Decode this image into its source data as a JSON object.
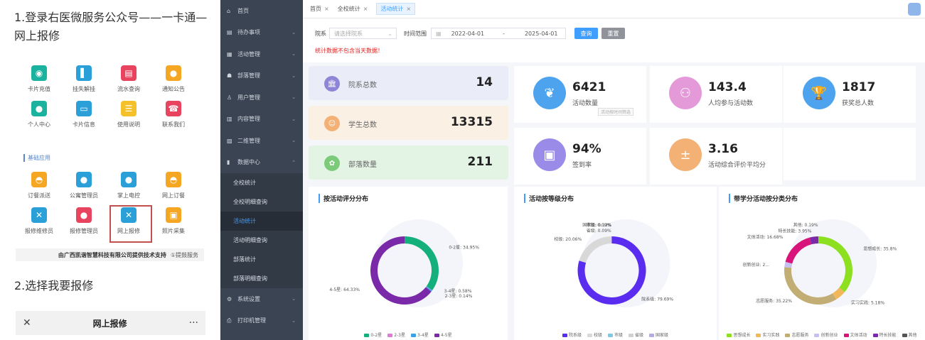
{
  "guide": {
    "step1": "1.登录右医微服务公众号——一卡通—网上报修",
    "step2": "2.选择我要报修",
    "section_label": "基础应用",
    "support": "由广西凯谐智慧科技有限公司提供技术支持",
    "support_tag": "①提鼓服务",
    "grid1": [
      {
        "label": "卡片充值",
        "icon": "wallet-icon",
        "color": "#1bb3a0"
      },
      {
        "label": "挂失解挂",
        "icon": "lock-card-icon",
        "color": "#2ba0d8"
      },
      {
        "label": "流水查询",
        "icon": "receipt-icon",
        "color": "#e8445f"
      },
      {
        "label": "通知公告",
        "icon": "person-icon",
        "color": "#f5a623"
      },
      {
        "label": "个人中心",
        "icon": "user-icon",
        "color": "#1bb3a0"
      },
      {
        "label": "卡片信息",
        "icon": "card-icon",
        "color": "#2ba0d8"
      },
      {
        "label": "使用说明",
        "icon": "document-icon",
        "color": "#f5c12a"
      },
      {
        "label": "联系我们",
        "icon": "phone-icon",
        "color": "#e8445f"
      }
    ],
    "grid2": [
      {
        "label": "订餐派送",
        "icon": "dish-icon",
        "color": "#f5a623"
      },
      {
        "label": "公寓管理员",
        "icon": "admin-icon",
        "color": "#2ba0d8"
      },
      {
        "label": "掌上电控",
        "icon": "drop-icon",
        "color": "#2ba0d8"
      },
      {
        "label": "网上订餐",
        "icon": "cloche-icon",
        "color": "#f5a623"
      },
      {
        "label": "报修维修员",
        "icon": "tools-icon",
        "color": "#2ba0d8"
      },
      {
        "label": "报修管理员",
        "icon": "admin-icon",
        "color": "#e8445f"
      },
      {
        "label": "网上报修",
        "icon": "tools-icon",
        "color": "#2ba0d8"
      },
      {
        "label": "照片采集",
        "icon": "photo-icon",
        "color": "#f5a623"
      }
    ],
    "bottom_bar": {
      "title": "网上报修",
      "close": "✕",
      "more": "···"
    }
  },
  "sidebar": [
    {
      "label": "首页",
      "icon": "⌂",
      "chev": ""
    },
    {
      "label": "待办事项",
      "icon": "▤",
      "chev": "⌄"
    },
    {
      "label": "活动管理",
      "icon": "▦",
      "chev": "⌄"
    },
    {
      "label": "部落管理",
      "icon": "☗",
      "chev": "⌄"
    },
    {
      "label": "用户管理",
      "icon": "♙",
      "chev": "⌄"
    },
    {
      "label": "内容管理",
      "icon": "▥",
      "chev": "⌄"
    },
    {
      "label": "二维管理",
      "icon": "▨",
      "chev": "⌄"
    },
    {
      "label": "数据中心",
      "icon": "▮",
      "chev": "⌃"
    }
  ],
  "sidebar_sub": [
    {
      "label": "全校统计",
      "active": false
    },
    {
      "label": "全校明细查询",
      "active": false
    },
    {
      "label": "活动统计",
      "active": true
    },
    {
      "label": "活动明细查询",
      "active": false
    },
    {
      "label": "部落统计",
      "active": false
    },
    {
      "label": "部落明细查询",
      "active": false
    }
  ],
  "sidebar_bottom": [
    {
      "label": "系统设置",
      "icon": "⚙",
      "chev": "⌄"
    },
    {
      "label": "打印机管理",
      "icon": "⎙",
      "chev": "⌄"
    }
  ],
  "tabs": [
    {
      "label": "首页",
      "active": false
    },
    {
      "label": "全校统计",
      "active": false
    },
    {
      "label": "活动统计",
      "active": true
    }
  ],
  "filter": {
    "dept_label": "院系",
    "dept_placeholder": "请选择院系",
    "time_label": "时间范围",
    "date_from": "2022-04-01",
    "date_sep": "-",
    "date_to": "2025-04-01",
    "query_btn": "查询",
    "reset_btn": "重置",
    "warning": "统计数据不包含当天数据！"
  },
  "stats": [
    {
      "label": "院系总数",
      "value": "14",
      "icon": "🏛",
      "bg": "#eaedf7",
      "ic": "#8f85d6"
    },
    {
      "label": "学生总数",
      "value": "13315",
      "icon": "☺",
      "bg": "#fbf0e4",
      "ic": "#f4b176"
    },
    {
      "label": "部落数量",
      "value": "211",
      "icon": "✿",
      "bg": "#e4f4e4",
      "ic": "#7ccb7a"
    }
  ],
  "kpis": [
    {
      "num": "6421",
      "cap": "活动数量",
      "icon": "❦",
      "color": "#4da3ee",
      "tip": "活动按时间筛选"
    },
    {
      "num": "143.4",
      "cap": "人均参与活动数",
      "icon": "⚇",
      "color": "#e49ad8",
      "tip": ""
    },
    {
      "num": "1817",
      "cap": "获奖总人数",
      "icon": "🏆",
      "color": "#4da3ee",
      "tip": ""
    },
    {
      "num": "94%",
      "cap": "签到率",
      "icon": "▣",
      "color": "#9b8be8",
      "tip": ""
    },
    {
      "num": "3.16",
      "cap": "活动综合评价平均分",
      "icon": "±",
      "color": "#f4b176",
      "tip": ""
    }
  ],
  "chart_data": [
    {
      "type": "pie",
      "title": "按活动评分分布",
      "categories": [
        "0-2星",
        "2-3星",
        "3-4星",
        "4-5星"
      ],
      "values": [
        34.95,
        0.14,
        0.58,
        64.33
      ],
      "colors": [
        "#13b07c",
        "#e07ad8",
        "#3aa0e8",
        "#7a2aa8"
      ],
      "labels": [
        "0-2星: 34.95%",
        "2-3星: 0.14%",
        "3-4星: 0.58%",
        "4-5星: 64.33%"
      ]
    },
    {
      "type": "pie",
      "title": "活动按等级分布",
      "categories": [
        "院系级",
        "校级",
        "市级",
        "省级",
        "国家级"
      ],
      "values": [
        79.69,
        20.06,
        0.09,
        0.09,
        0.13
      ],
      "colors": [
        "#5a2cf0",
        "#d8d8d8",
        "#7bc8e8",
        "#d0d0d0",
        "#b8a8e8"
      ],
      "labels": [
        "院系级: 79.69%",
        "校级: 20.06%",
        "市级: 0.09%",
        "省级: 0.09%",
        "国家级: 0.13%"
      ]
    },
    {
      "type": "pie",
      "title": "带学分活动按分类分布",
      "categories": [
        "思想成长",
        "实习实践",
        "志愿服务",
        "创新创业",
        "文体活动",
        "特长技能",
        "其他"
      ],
      "values": [
        35.8,
        5.18,
        35.22,
        2.5,
        16.68,
        3.95,
        0.19
      ],
      "colors": [
        "#8de020",
        "#f0b85a",
        "#c2ae74",
        "#c6c0f0",
        "#d8137a",
        "#7a2aa8",
        "#555555"
      ],
      "labels": [
        "思想成长: 35.8%",
        "实习实践: 5.18%",
        "志愿服务: 35.22%",
        "创新创业: 2...",
        "文体活动: 16.68%",
        "特长技能: 3.95%",
        "其他: 0.19%"
      ]
    }
  ]
}
